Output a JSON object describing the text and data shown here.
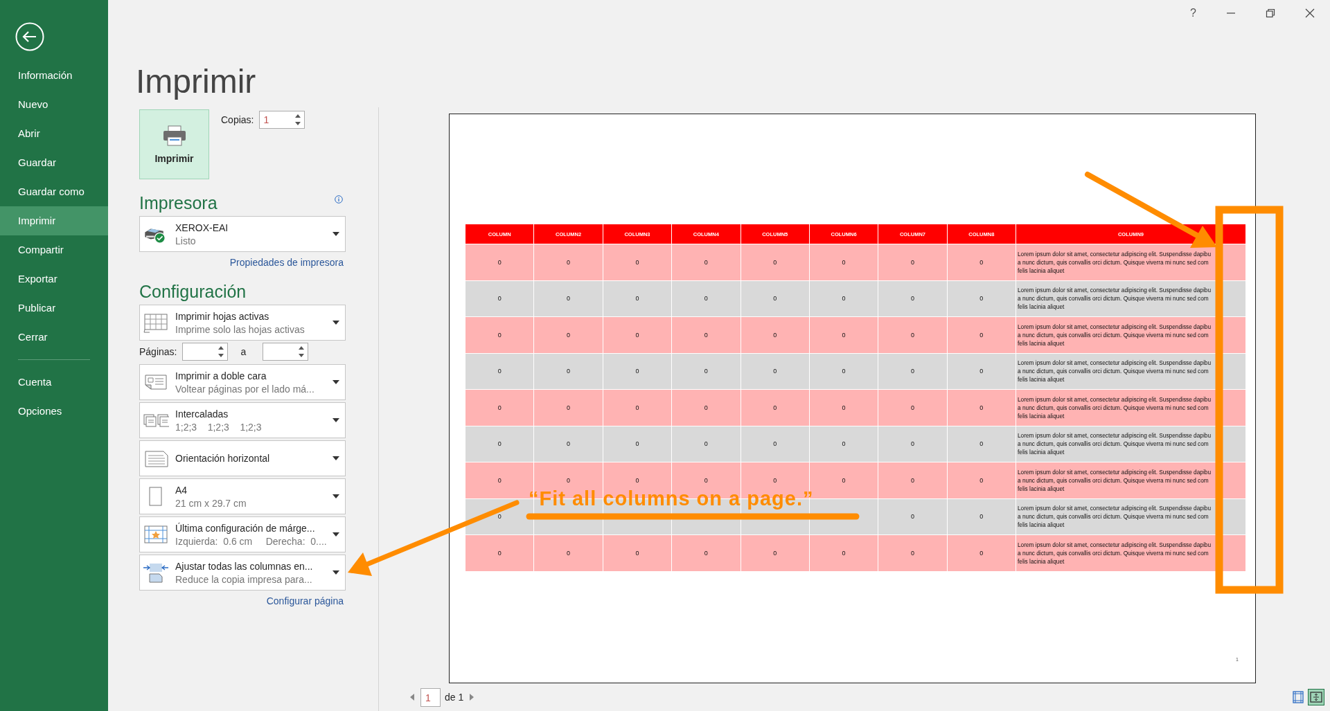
{
  "window": {
    "help_label": "?"
  },
  "sidebar": {
    "groups": [
      [
        {
          "label": "Información",
          "selected": false
        },
        {
          "label": "Nuevo",
          "selected": false
        },
        {
          "label": "Abrir",
          "selected": false
        },
        {
          "label": "Guardar",
          "selected": false
        },
        {
          "label": "Guardar como",
          "selected": false
        },
        {
          "label": "Imprimir",
          "selected": true
        },
        {
          "label": "Compartir",
          "selected": false
        },
        {
          "label": "Exportar",
          "selected": false
        },
        {
          "label": "Publicar",
          "selected": false
        },
        {
          "label": "Cerrar",
          "selected": false
        }
      ],
      [
        {
          "label": "Cuenta",
          "selected": false
        },
        {
          "label": "Opciones",
          "selected": false
        }
      ]
    ]
  },
  "page_title": "Imprimir",
  "print_button": {
    "label": "Imprimir"
  },
  "copies": {
    "label": "Copias:",
    "value": "1"
  },
  "printer": {
    "heading": "Impresora",
    "name": "XEROX-EAI",
    "status": "Listo",
    "ready": true,
    "properties_link": "Propiedades de impresora"
  },
  "settings": {
    "heading": "Configuración",
    "items": [
      {
        "kind": "sheets",
        "title": "Imprimir hojas activas",
        "subtitle": "Imprime solo las hojas activas"
      },
      {
        "kind": "pages",
        "label": "Páginas:",
        "to_label": "a"
      },
      {
        "kind": "duplex",
        "title": "Imprimir a doble cara",
        "subtitle": "Voltear páginas por el lado má..."
      },
      {
        "kind": "collate",
        "title": "Intercaladas",
        "subtitle": "1;2;3    1;2;3    1;2;3"
      },
      {
        "kind": "orientation",
        "title": "Orientación horizontal"
      },
      {
        "kind": "paper",
        "title": "A4",
        "subtitle": "21 cm x 29.7 cm"
      },
      {
        "kind": "margins",
        "title": "Última configuración de márge...",
        "subtitle": "Izquierda:  0.6 cm     Derecha:  0...."
      },
      {
        "kind": "scaling",
        "title": "Ajustar todas las columnas en...",
        "subtitle": "Reduce la copia impresa para..."
      }
    ],
    "setup_link": "Configurar página"
  },
  "preview": {
    "columns": [
      "COLUMN",
      "COLUMN2",
      "COLUMN3",
      "COLUMN4",
      "COLUMN5",
      "COLUMN6",
      "COLUMN7",
      "COLUMN8",
      "COLUMN9"
    ],
    "rows": [
      {
        "cells": [
          "0",
          "0",
          "0",
          "0",
          "0",
          "0",
          "0",
          "0",
          "Lorem ipsum dolor sit amet, consectetur adipiscing elit. Suspendisse dapibu\na nunc dictum, quis convallis orci dictum. Quisque viverra mi nunc sed com\nfelis lacinia aliquet"
        ]
      },
      {
        "cells": [
          "0",
          "0",
          "0",
          "0",
          "0",
          "0",
          "0",
          "0",
          "Lorem ipsum dolor sit amet, consectetur adipiscing elit. Suspendisse dapibu\na nunc dictum, quis convallis orci dictum. Quisque viverra mi nunc sed com\nfelis lacinia aliquet"
        ]
      },
      {
        "cells": [
          "0",
          "0",
          "0",
          "0",
          "0",
          "0",
          "0",
          "0",
          "Lorem ipsum dolor sit amet, consectetur adipiscing elit. Suspendisse dapibu\na nunc dictum, quis convallis orci dictum. Quisque viverra mi nunc sed com\nfelis lacinia aliquet"
        ]
      },
      {
        "cells": [
          "0",
          "0",
          "0",
          "0",
          "0",
          "0",
          "0",
          "0",
          "Lorem ipsum dolor sit amet, consectetur adipiscing elit. Suspendisse dapibu\na nunc dictum, quis convallis orci dictum. Quisque viverra mi nunc sed com\nfelis lacinia aliquet"
        ]
      },
      {
        "cells": [
          "0",
          "0",
          "0",
          "0",
          "0",
          "0",
          "0",
          "0",
          "Lorem ipsum dolor sit amet, consectetur adipiscing elit. Suspendisse dapibu\na nunc dictum, quis convallis orci dictum. Quisque viverra mi nunc sed com\nfelis lacinia aliquet"
        ]
      },
      {
        "cells": [
          "0",
          "0",
          "0",
          "0",
          "0",
          "0",
          "0",
          "0",
          "Lorem ipsum dolor sit amet, consectetur adipiscing elit. Suspendisse dapibu\na nunc dictum, quis convallis orci dictum. Quisque viverra mi nunc sed com\nfelis lacinia aliquet"
        ]
      },
      {
        "cells": [
          "0",
          "0",
          "0",
          "0",
          "0",
          "0",
          "0",
          "0",
          "Lorem ipsum dolor sit amet, consectetur adipiscing elit. Suspendisse dapibu\na nunc dictum, quis convallis orci dictum. Quisque viverra mi nunc sed com\nfelis lacinia aliquet"
        ]
      },
      {
        "cells": [
          "0",
          null,
          null,
          null,
          null,
          null,
          "0",
          "0",
          "Lorem ipsum dolor sit amet, consectetur adipiscing elit. Suspendisse dapibu\na nunc dictum, quis convallis orci dictum. Quisque viverra mi nunc sed com\nfelis lacinia aliquet"
        ]
      },
      {
        "cells": [
          "0",
          "0",
          "0",
          "0",
          "0",
          "0",
          "0",
          "0",
          "Lorem ipsum dolor sit amet, consectetur adipiscing elit. Suspendisse dapibu\na nunc dictum, quis convallis orci dictum. Quisque viverra mi nunc sed com\nfelis lacinia aliquet"
        ]
      }
    ],
    "page_number": "1",
    "callout": "“Fit all columns on a page.”"
  },
  "pager": {
    "current": "1",
    "total_label": "de 1"
  },
  "view_toggles": [
    {
      "kind": "margins",
      "selected": false
    },
    {
      "kind": "fit",
      "selected": true
    }
  ]
}
